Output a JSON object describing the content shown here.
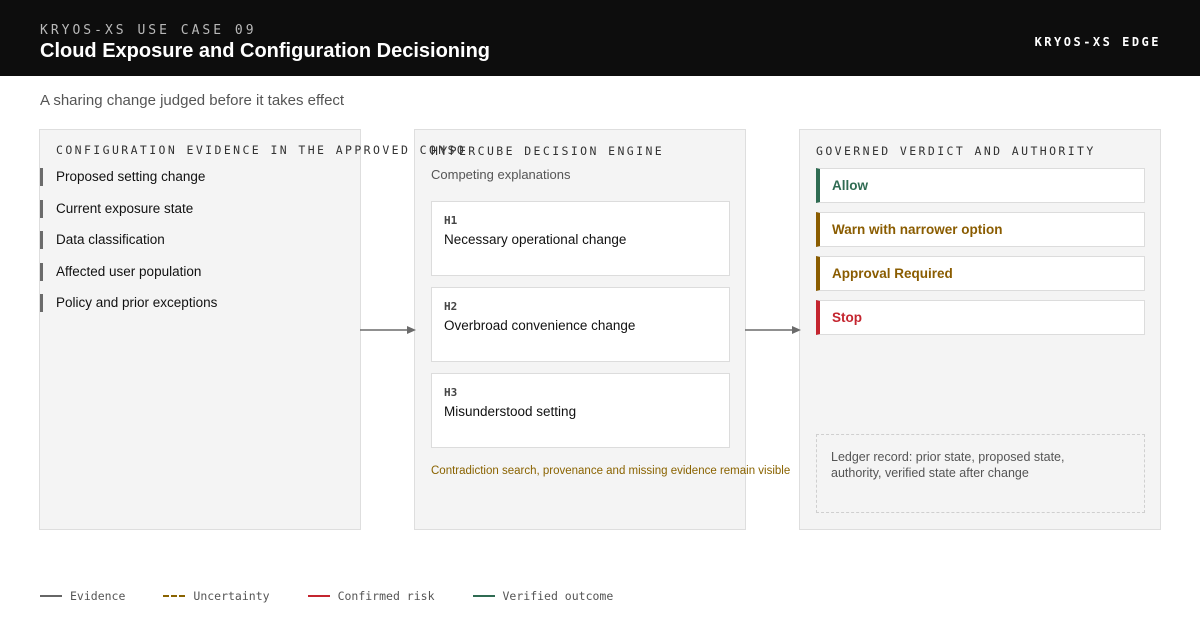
{
  "header": {
    "eyebrow": "KRYOS-XS USE CASE 09",
    "title": "Cloud Exposure and Configuration Decisioning",
    "brand": "KRYOS-XS EDGE"
  },
  "subtitle": "A sharing change judged before it takes effect",
  "evidence_panel": {
    "title": "CONFIGURATION EVIDENCE IN THE APPROVED CONSO",
    "items": [
      "Proposed setting change",
      "Current exposure state",
      "Data classification",
      "Affected user population",
      "Policy and prior exceptions"
    ]
  },
  "engine_panel": {
    "title": "HYPERCUBE DECISION ENGINE",
    "subtitle": "Competing explanations",
    "hypotheses": [
      {
        "id": "H1",
        "text": "Necessary operational change"
      },
      {
        "id": "H2",
        "text": "Overbroad convenience change"
      },
      {
        "id": "H3",
        "text": "Misunderstood setting"
      }
    ],
    "note": "Contradiction search, provenance and missing evidence remain visible"
  },
  "verdict_panel": {
    "title": "GOVERNED VERDICT AND AUTHORITY",
    "verdicts": [
      {
        "label": "Allow",
        "color": "#2f6b52"
      },
      {
        "label": "Warn with narrower option",
        "color": "#8a5c00"
      },
      {
        "label": "Approval Required",
        "color": "#8a5c00"
      },
      {
        "label": "Stop",
        "color": "#c4252f"
      }
    ],
    "ledger": "Ledger record: prior state, proposed state, authority, verified state after change"
  },
  "legend": [
    {
      "label": "Evidence",
      "color": "#666666"
    },
    {
      "label": "Uncertainty",
      "color": "#8a6300"
    },
    {
      "label": "Confirmed risk",
      "color": "#c4252f"
    },
    {
      "label": "Verified outcome",
      "color": "#2f6b52"
    }
  ]
}
